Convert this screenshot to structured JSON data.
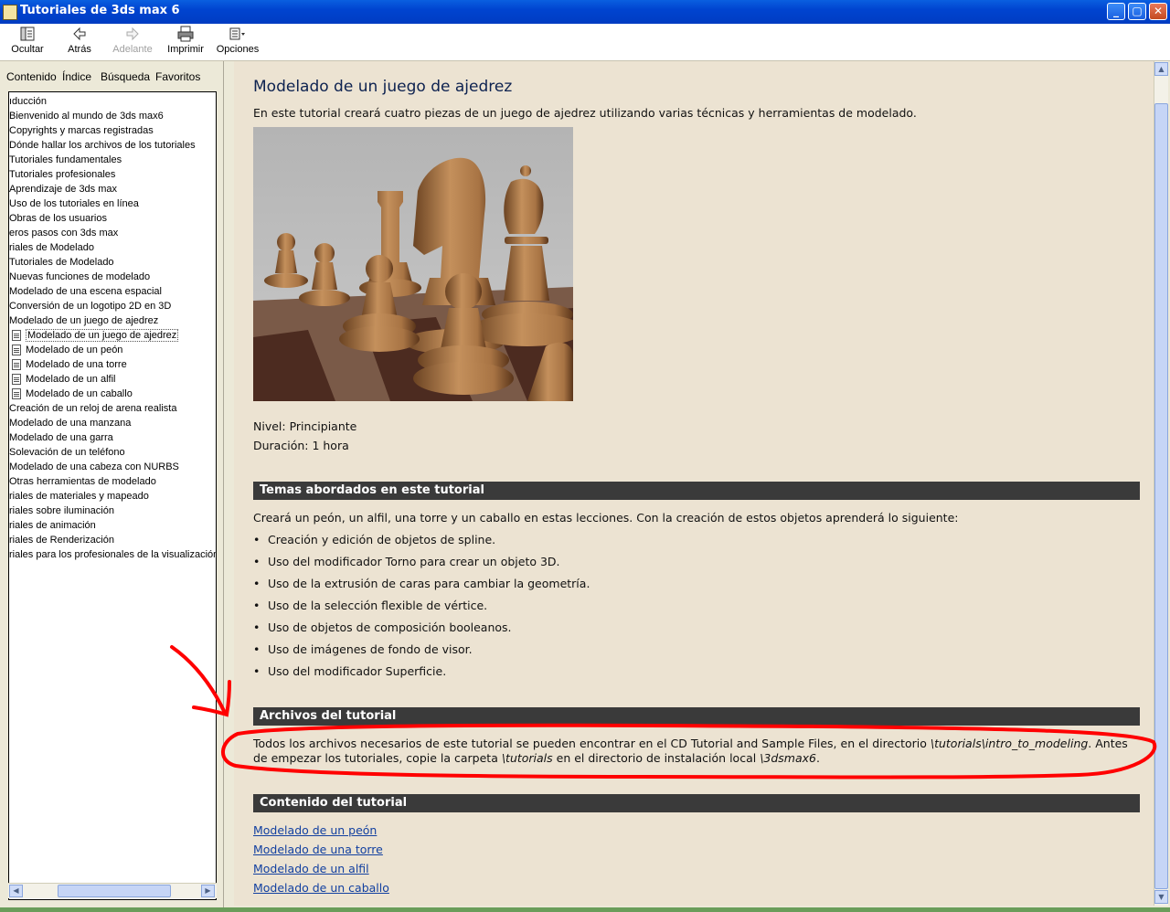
{
  "window": {
    "title": "Tutoriales de 3ds max 6",
    "minimize_symbol": "_",
    "restore_symbol": "▢",
    "close_symbol": "✕"
  },
  "toolbar": {
    "hide_label": "Ocultar",
    "back_label": "Atrás",
    "forward_label": "Adelante",
    "print_label": "Imprimir",
    "options_label": "Opciones"
  },
  "tabs": {
    "contents": "Contenido",
    "index": "Índice",
    "search": "Búsqueda",
    "favorites": "Favoritos"
  },
  "tree": [
    {
      "label": "ıducción",
      "sub": false
    },
    {
      "label": "Bienvenido al mundo de 3ds max6",
      "sub": false
    },
    {
      "label": "Copyrights y marcas registradas",
      "sub": false
    },
    {
      "label": "Dónde hallar los archivos de los tutoriales",
      "sub": false
    },
    {
      "label": "Tutoriales fundamentales",
      "sub": false
    },
    {
      "label": "Tutoriales profesionales",
      "sub": false
    },
    {
      "label": "Aprendizaje de 3ds max",
      "sub": false
    },
    {
      "label": "Uso de los tutoriales en línea",
      "sub": false
    },
    {
      "label": "Obras de los usuarios",
      "sub": false
    },
    {
      "label": "eros pasos con 3ds max",
      "sub": false
    },
    {
      "label": "riales de Modelado",
      "sub": false
    },
    {
      "label": "Tutoriales de Modelado",
      "sub": false
    },
    {
      "label": "Nuevas funciones de modelado",
      "sub": false
    },
    {
      "label": "Modelado de una escena espacial",
      "sub": false
    },
    {
      "label": "Conversión de un logotipo 2D en 3D",
      "sub": false
    },
    {
      "label": "Modelado de un juego de ajedrez",
      "sub": false
    },
    {
      "label": "Modelado de un juego de ajedrez",
      "sub": true,
      "selected": true
    },
    {
      "label": "Modelado de un peón",
      "sub": true
    },
    {
      "label": "Modelado de una torre",
      "sub": true
    },
    {
      "label": "Modelado de un alfil",
      "sub": true
    },
    {
      "label": "Modelado de un caballo",
      "sub": true
    },
    {
      "label": "Creación de un reloj de arena realista",
      "sub": false
    },
    {
      "label": "Modelado de una manzana",
      "sub": false
    },
    {
      "label": "Modelado de una garra",
      "sub": false
    },
    {
      "label": "Solevación de un teléfono",
      "sub": false
    },
    {
      "label": "Modelado de una cabeza con NURBS",
      "sub": false
    },
    {
      "label": "Otras herramientas de modelado",
      "sub": false
    },
    {
      "label": "riales de materiales y mapeado",
      "sub": false
    },
    {
      "label": "riales sobre iluminación",
      "sub": false
    },
    {
      "label": "riales de animación",
      "sub": false
    },
    {
      "label": "riales de Renderización",
      "sub": false
    },
    {
      "label": "riales para los profesionales de la visualización",
      "sub": false
    }
  ],
  "content": {
    "title": "Modelado de un juego de ajedrez",
    "intro": "En este tutorial creará cuatro piezas de un juego de ajedrez utilizando varias técnicas y herramientas de modelado.",
    "level": "Nivel: Principiante",
    "duration": "Duración: 1 hora",
    "topics_heading": "Temas abordados en este tutorial",
    "topics_intro": "Creará un peón, un alfil, una torre y un caballo en estas lecciones. Con la creación de estos objetos aprenderá lo siguiente:",
    "topics": [
      "Creación y edición de objetos de spline.",
      "Uso del modificador Torno para crear un objeto 3D.",
      "Uso de la extrusión de caras para cambiar la geometría.",
      "Uso de la selección flexible de vértice.",
      "Uso de objetos de composición booleanos.",
      "Uso de imágenes de fondo de visor.",
      "Uso del modificador Superficie."
    ],
    "files_heading": "Archivos del tutorial",
    "files_text_1a": "Todos los archivos necesarios de este tutorial se pueden encontrar en el CD Tutorial and Sample Files, en el directorio ",
    "files_path_1": "\\tutorials\\intro_to_modeling",
    "files_text_1b": ". Antes",
    "files_text_2a": "de empezar los tutoriales, copie la carpeta ",
    "files_path_2": "\\tutorials",
    "files_text_2b": " en el directorio de instalación local ",
    "files_path_3": "\\3dsmax6",
    "files_text_2c": ".",
    "contents_heading": "Contenido del tutorial",
    "links": [
      "Modelado de un peón",
      "Modelado de una torre",
      "Modelado de un alfil",
      "Modelado de un caballo"
    ]
  },
  "colors": {
    "annotation": "#ff0000",
    "titlebar": "#0044d0",
    "content_bg": "#ece3d2",
    "section_bar": "#3a3a3a",
    "link": "#1240a0"
  },
  "icons": {
    "hide": "hide-pane-icon",
    "back": "back-arrow-icon",
    "forward": "forward-arrow-icon",
    "print": "printer-icon",
    "options": "options-icon"
  }
}
